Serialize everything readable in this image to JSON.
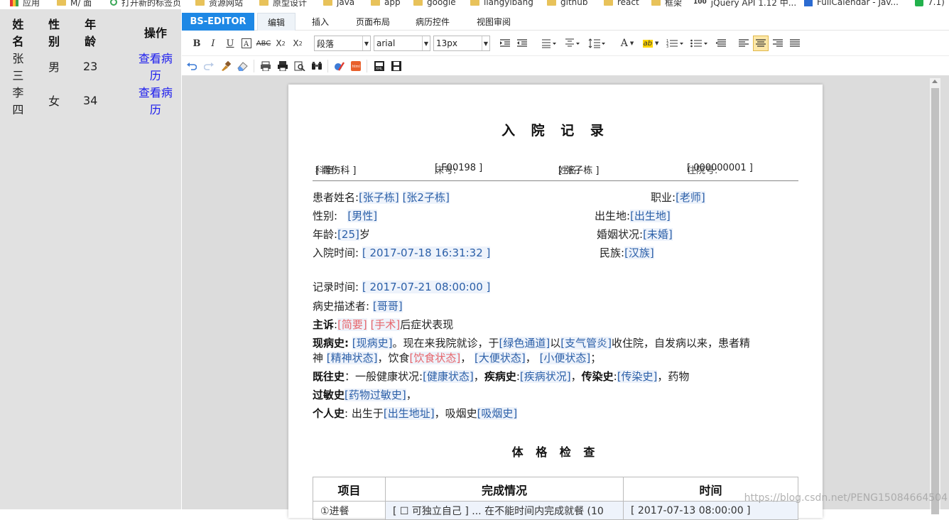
{
  "bookmarks": [
    {
      "label": "应用",
      "icon": "apps-grid-icon"
    },
    {
      "label": "M/ 面",
      "icon": "folder-icon"
    },
    {
      "label": "打开新的标签页",
      "icon": "reload-icon"
    },
    {
      "label": "资源网站",
      "icon": "folder-icon"
    },
    {
      "label": "原型设计",
      "icon": "folder-icon"
    },
    {
      "label": "java",
      "icon": "folder-icon"
    },
    {
      "label": "app",
      "icon": "folder-icon"
    },
    {
      "label": "google",
      "icon": "folder-icon"
    },
    {
      "label": "liangyibang",
      "icon": "folder-icon"
    },
    {
      "label": "github",
      "icon": "folder-icon"
    },
    {
      "label": "react",
      "icon": "folder-icon"
    },
    {
      "label": "框架",
      "icon": "folder-icon"
    },
    {
      "label": "jQuery API 1.12 中...",
      "icon": "jquery-icon"
    },
    {
      "label": "FullCalendar - Jav...",
      "icon": "page-icon"
    },
    {
      "label": "7.1)",
      "icon": "green-icon"
    }
  ],
  "patients": {
    "headers": [
      "姓名",
      "性别",
      "年龄",
      "操作"
    ],
    "rows": [
      {
        "name": "张三",
        "gender": "男",
        "age": "23",
        "action": "查看病历"
      },
      {
        "name": "李四",
        "gender": "女",
        "age": "34",
        "action": "查看病历"
      }
    ]
  },
  "editor": {
    "brand": "BS-EDITOR",
    "tabs": [
      "编辑",
      "插入",
      "页面布局",
      "病历控件",
      "视图审阅"
    ],
    "active_tab": "编辑",
    "paragraph_select": "段落",
    "font_select": "arial",
    "size_select": "13px"
  },
  "doc": {
    "title": "入 院 记 录",
    "header": {
      "dept_label": "科室:",
      "dept_value": "[ 骨伤科 ]",
      "bed_label": "床号:",
      "bed_value": "[ F00198 ]",
      "name_label": "姓名:",
      "name_value": "[ 张子栋 ]",
      "admit_no_label": "住院号:",
      "admit_no_value": "[ 000000001 ]"
    },
    "patient_name_label": "患者姓名:",
    "patient_name_value1": "[张子栋]",
    "patient_name_value2": "[张2子栋]",
    "job_label": "职业:",
    "job_value": "[老师]",
    "gender_label": "性别:",
    "gender_value": "[男性]",
    "birthplace_label": "出生地:",
    "birthplace_value": "[出生地]",
    "age_label": "年龄:",
    "age_value": "[25]",
    "age_unit": "岁",
    "marital_label": "婚姻状况:",
    "marital_value": "[未婚]",
    "admit_time_label": "入院时间:",
    "admit_time_value": "[ 2017-07-18 16:31:32 ]",
    "ethnic_label": "民族:",
    "ethnic_value": "[汉族]",
    "record_time_label": "记录时间:",
    "record_time_value": "[ 2017-07-21 08:00:00 ]",
    "narrator_label": "病史描述者:",
    "narrator_value": "[哥哥]",
    "complaint_label": "主诉",
    "complaint_sep": ":",
    "complaint_value1": "[简要]",
    "complaint_value2": "[手术]",
    "complaint_tail": "后症状表现",
    "present_label": "现病史:",
    "present_v1": "[现病史]",
    "present_t1": "。现在来我院就诊，于",
    "present_v2": "[绿色通道]",
    "present_t2": "以",
    "present_v3": "[支气管炎]",
    "present_t3": "收住院，自发病以来，患者精",
    "present_t4": "神",
    "present_v4": "[精神状态]",
    "present_t5": "，饮食",
    "present_v5": "[饮食状态]",
    "present_t6": "，",
    "present_v6": "[大便状态]",
    "present_t7": "，",
    "present_v7": "[小便状态]",
    "present_t8": "；",
    "past_label": "既往史",
    "past_t1": "：一般健康状况:",
    "past_v1": "[健康状态]",
    "past_t2": "，",
    "disease_label": "疾病史",
    "disease_sep": ":",
    "disease_value": "[疾病状况]",
    "disease_t2": "，",
    "infect_label": "传染史",
    "infect_sep": ":",
    "infect_value": "[传染史]",
    "infect_t2": "，药物",
    "allergy_label": "过敏史",
    "allergy_value": "[药物过敏史]",
    "allergy_t2": "，",
    "personal_label": "个人史",
    "personal_t1": ": 出生于",
    "personal_v1": "[出生地址]",
    "personal_t2": "，吸烟史",
    "personal_v2": "[吸烟史]",
    "exam_title": "体 格 检 查",
    "exam_headers": [
      "项目",
      "完成情况",
      "时间"
    ],
    "exam_row": [
      "①进餐",
      "[ ☐ 可独立自己 ] ... 在不能时间内完成就餐 (10",
      "[ 2017-07-13 08:00:00 ]"
    ]
  },
  "watermark": "https://blog.csdn.net/PENG15084664504"
}
